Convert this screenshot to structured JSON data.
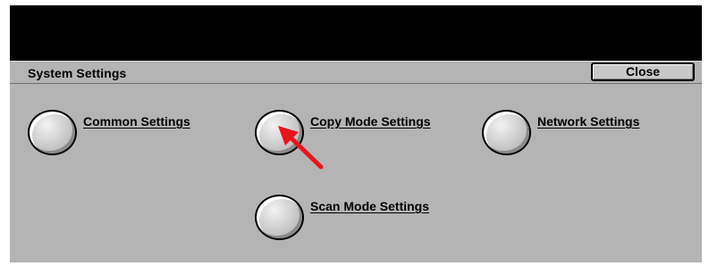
{
  "header": {
    "title": "System Settings",
    "close_label": "Close"
  },
  "options": {
    "common": {
      "label": "Common Settings"
    },
    "copy_mode": {
      "label": "Copy Mode Settings"
    },
    "network": {
      "label": "Network Settings"
    },
    "scan_mode": {
      "label": "Scan Mode Settings"
    }
  },
  "annotation": {
    "arrow_color": "#e8141c",
    "arrow_icon": "red-pointer-arrow"
  },
  "colors": {
    "panel": "#b4b4b4",
    "top_bar": "#000000"
  }
}
